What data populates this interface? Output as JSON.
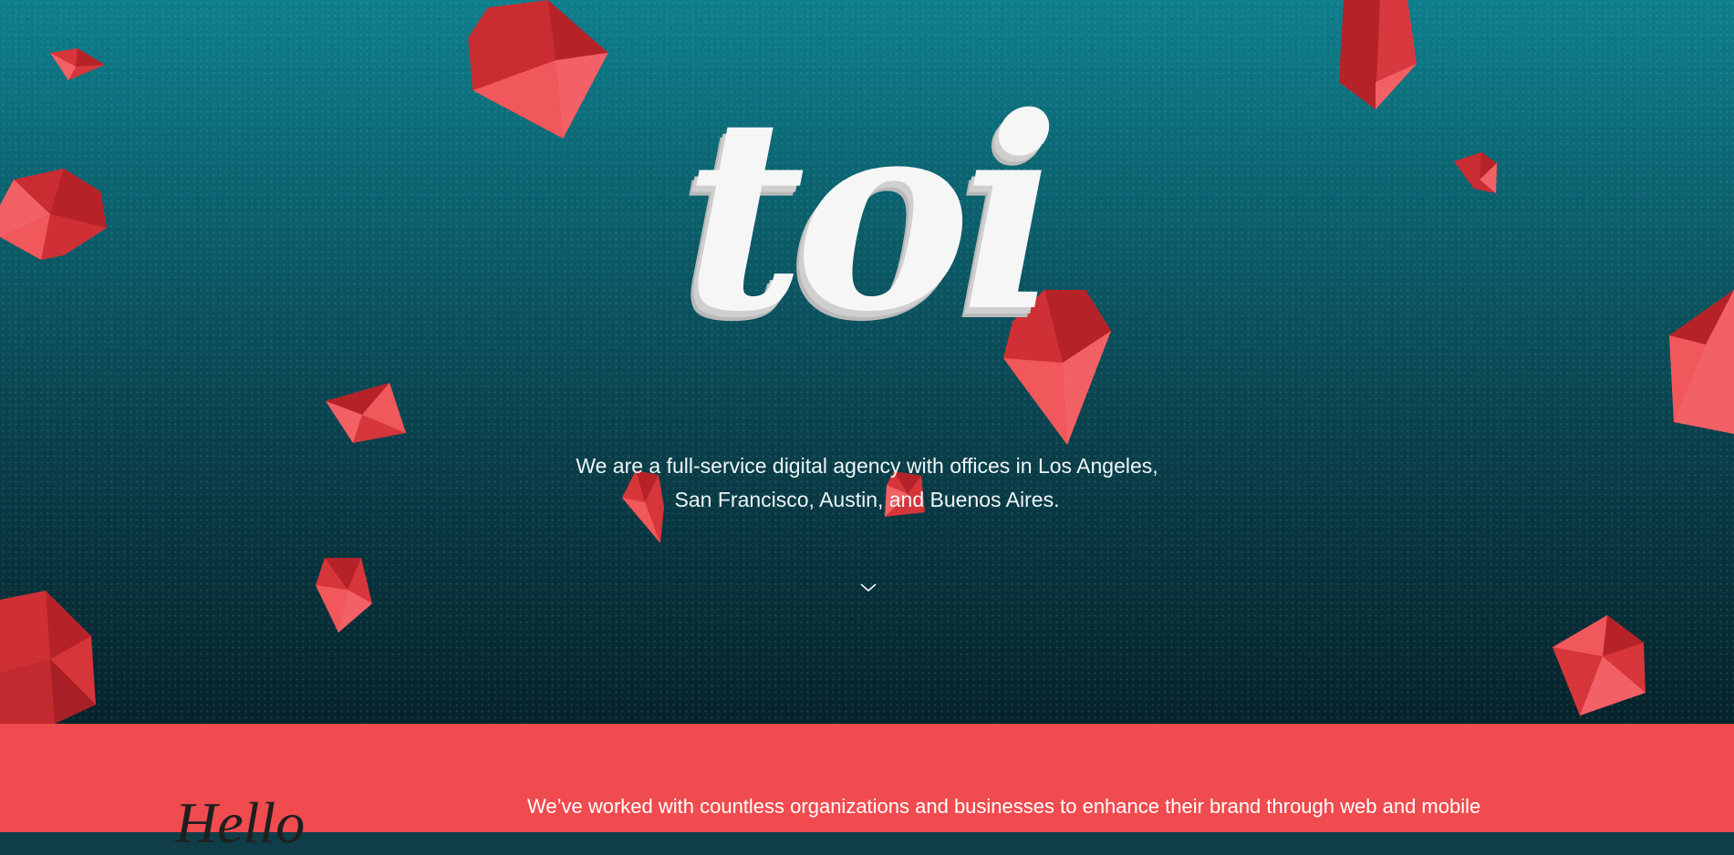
{
  "hero": {
    "logo_text": "toi",
    "tagline_line1": "We are a full-service digital agency with offices in Los Angeles,",
    "tagline_line2": "San Francisco, Austin, and Buenos Aires.",
    "scroll_icon": "chevron-down-icon"
  },
  "intro": {
    "heading": "Hello",
    "body": "We’ve worked with countless organizations and businesses to enhance their brand through web and mobile"
  },
  "colors": {
    "hero_top": "#0f7f8d",
    "hero_bottom": "#06232b",
    "accent_red": "#f04b4f",
    "logo_white": "#f6f6f6"
  },
  "decorations": {
    "gem_icon": "red-crystal-gem"
  }
}
